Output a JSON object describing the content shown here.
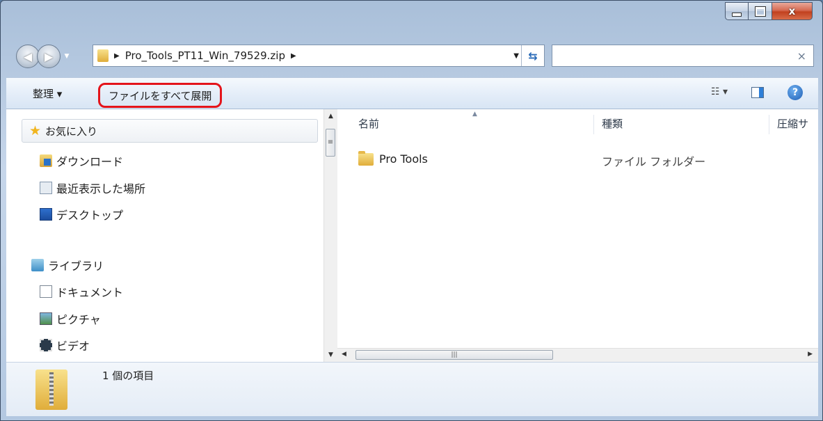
{
  "window": {
    "caption": {
      "minimize": "",
      "maximize": "",
      "close": "x"
    }
  },
  "address": {
    "path": "Pro_Tools_PT11_Win_79529.zip",
    "search_placeholder": "",
    "search_clear": "×"
  },
  "toolbar": {
    "organize_label": "整理 ▾",
    "extract_all_label": "ファイルをすべて展開",
    "view_label": "▾",
    "help_label": "?"
  },
  "sidebar": {
    "favorites": {
      "label": "お気に入り"
    },
    "items": [
      {
        "label": "ダウンロード",
        "icon": "downloads-folder-icon"
      },
      {
        "label": "最近表示した場所",
        "icon": "recent-places-icon"
      },
      {
        "label": "デスクトップ",
        "icon": "desktop-icon"
      }
    ],
    "libraries": {
      "label": "ライブラリ"
    },
    "library_items": [
      {
        "label": "ドキュメント",
        "icon": "documents-icon"
      },
      {
        "label": "ピクチャ",
        "icon": "pictures-icon"
      },
      {
        "label": "ビデオ",
        "icon": "videos-icon"
      }
    ]
  },
  "content": {
    "columns": {
      "name": "名前",
      "type": "種類",
      "compressed": "圧縮サ"
    },
    "rows": [
      {
        "name": "Pro Tools",
        "type": "ファイル フォルダー"
      }
    ]
  },
  "details": {
    "count_text": "1 個の項目"
  }
}
